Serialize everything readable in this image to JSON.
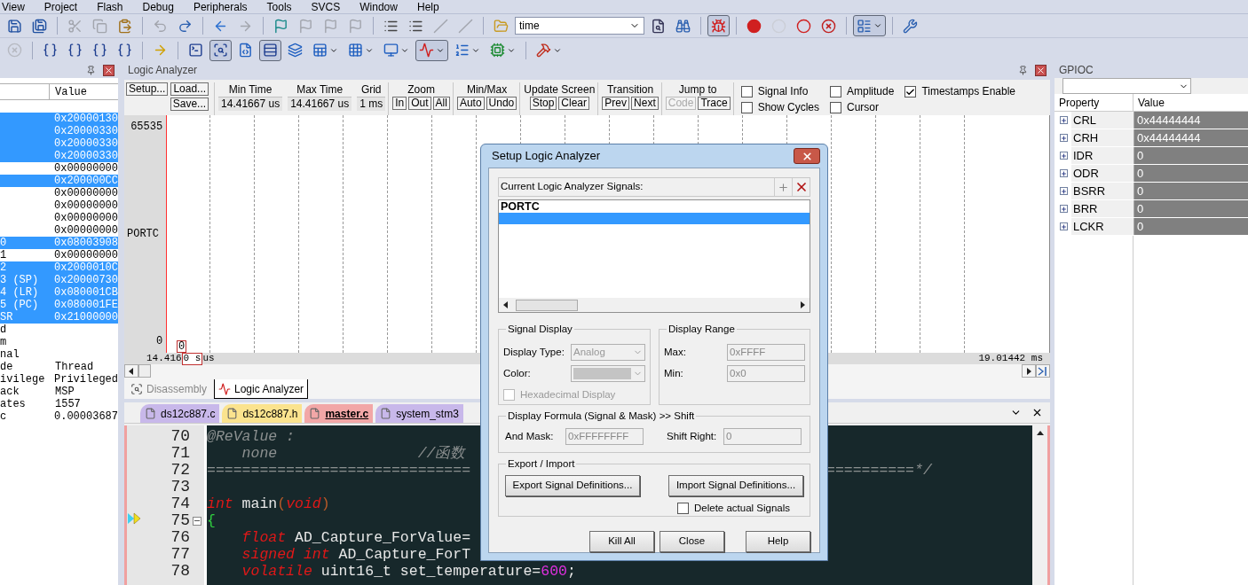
{
  "menu": [
    "View",
    "Project",
    "Flash",
    "Debug",
    "Peripherals",
    "Tools",
    "SVCS",
    "Window",
    "Help"
  ],
  "toolbar_1": [
    {
      "kind": "button",
      "disabled": false,
      "pressed": false
    },
    {
      "kind": "button",
      "disabled": false,
      "pressed": false
    },
    {
      "kind": "separator"
    },
    {
      "kind": "button",
      "disabled": true,
      "pressed": false
    },
    {
      "kind": "button",
      "disabled": true,
      "pressed": false
    },
    {
      "kind": "button",
      "disabled": false,
      "pressed": false
    },
    {
      "kind": "separator"
    },
    {
      "kind": "button",
      "disabled": true,
      "pressed": false
    },
    {
      "kind": "button",
      "disabled": false,
      "pressed": false
    },
    {
      "kind": "separator"
    },
    {
      "kind": "button",
      "disabled": false,
      "pressed": false
    },
    {
      "kind": "button",
      "disabled": true,
      "pressed": false
    },
    {
      "kind": "separator"
    },
    {
      "kind": "button",
      "disabled": false,
      "pressed": false
    },
    {
      "kind": "button",
      "disabled": true,
      "pressed": false
    },
    {
      "kind": "button",
      "disabled": true,
      "pressed": false
    },
    {
      "kind": "button",
      "disabled": true,
      "pressed": false
    },
    {
      "kind": "separator"
    },
    {
      "kind": "button",
      "disabled": false,
      "pressed": false
    },
    {
      "kind": "button",
      "disabled": false,
      "pressed": false
    },
    {
      "kind": "button",
      "disabled": true,
      "pressed": false
    },
    {
      "kind": "button",
      "disabled": true,
      "pressed": false
    },
    {
      "kind": "separator"
    },
    {
      "kind": "button",
      "disabled": false,
      "pressed": false
    },
    {
      "kind": "combo",
      "value": "time"
    },
    {
      "kind": "button",
      "disabled": false,
      "pressed": false
    },
    {
      "kind": "button",
      "disabled": false,
      "pressed": false
    },
    {
      "kind": "separator"
    },
    {
      "kind": "button",
      "disabled": false,
      "pressed": true
    },
    {
      "kind": "separator"
    },
    {
      "kind": "button",
      "disabled": false,
      "pressed": false
    },
    {
      "kind": "button",
      "disabled": true,
      "pressed": false
    },
    {
      "kind": "button",
      "disabled": false,
      "pressed": false
    },
    {
      "kind": "button",
      "disabled": false,
      "pressed": false
    },
    {
      "kind": "separator"
    },
    {
      "kind": "split",
      "disabled": false,
      "pressed": true
    },
    {
      "kind": "separator"
    },
    {
      "kind": "button",
      "disabled": false,
      "pressed": false
    }
  ],
  "toolbar_2": [
    {
      "kind": "button",
      "disabled": true,
      "pressed": false
    },
    {
      "kind": "separator"
    },
    {
      "kind": "button",
      "disabled": false,
      "pressed": false
    },
    {
      "kind": "button",
      "disabled": false,
      "pressed": false
    },
    {
      "kind": "button",
      "disabled": false,
      "pressed": false
    },
    {
      "kind": "button",
      "disabled": false,
      "pressed": false
    },
    {
      "kind": "separator"
    },
    {
      "kind": "button",
      "disabled": false,
      "pressed": false
    },
    {
      "kind": "separator"
    },
    {
      "kind": "button",
      "disabled": false,
      "pressed": false
    },
    {
      "kind": "button",
      "disabled": false,
      "pressed": true
    },
    {
      "kind": "button",
      "disabled": false,
      "pressed": false
    },
    {
      "kind": "button",
      "disabled": false,
      "pressed": true
    },
    {
      "kind": "button",
      "disabled": false,
      "pressed": false
    },
    {
      "kind": "split",
      "disabled": false,
      "pressed": false
    },
    {
      "kind": "split",
      "disabled": false,
      "pressed": false
    },
    {
      "kind": "split",
      "disabled": false,
      "pressed": false
    },
    {
      "kind": "split",
      "disabled": false,
      "pressed": true
    },
    {
      "kind": "split",
      "disabled": false,
      "pressed": false
    },
    {
      "kind": "split",
      "disabled": false,
      "pressed": false
    },
    {
      "kind": "separator"
    },
    {
      "kind": "split",
      "disabled": false,
      "pressed": false
    }
  ],
  "registers": {
    "value_column": "Value",
    "rows": [
      {
        "value": "0x20000130",
        "selected": true
      },
      {
        "value": "0x20000330",
        "selected": true
      },
      {
        "value": "0x20000330",
        "selected": true
      },
      {
        "value": "0x20000330",
        "selected": true
      },
      {
        "value": "0x00000000",
        "selected": false
      },
      {
        "value": "0x200000CC",
        "selected": true
      },
      {
        "value": "0x00000000",
        "selected": false
      },
      {
        "value": "0x00000000",
        "selected": false
      },
      {
        "value": "0x00000000",
        "selected": false
      },
      {
        "value": "0x00000000",
        "selected": false
      },
      {
        "name": "0",
        "value": "0x08003908",
        "selected": true
      },
      {
        "name": "1",
        "value": "0x00000000",
        "selected": false
      },
      {
        "name": "2",
        "value": "0x2000010C",
        "selected": true
      },
      {
        "name": "3 (SP)",
        "value": "0x20000730",
        "selected": true
      },
      {
        "name": "4 (LR)",
        "value": "0x080001CB",
        "selected": true
      },
      {
        "name": "5 (PC)",
        "value": "0x080001FE",
        "selected": true
      },
      {
        "name": "SR",
        "value": "0x21000000",
        "selected": true
      },
      {
        "name": "d",
        "selected": false
      },
      {
        "name": "m",
        "selected": false
      },
      {
        "name": "nal",
        "selected": false
      },
      {
        "name": "de",
        "value": "Thread",
        "selected": false
      },
      {
        "name": "ivilege",
        "value": "Privileged",
        "selected": false
      },
      {
        "name": "ack",
        "value": "MSP",
        "selected": false
      },
      {
        "name": "ates",
        "value": "1557",
        "selected": false
      },
      {
        "name": "c",
        "value": "0.00003687",
        "selected": false
      }
    ]
  },
  "logic_analyzer": {
    "title": "Logic Analyzer",
    "setup": "Setup...",
    "load": "Load...",
    "save": "Save...",
    "sections": [
      {
        "kind": "readout",
        "title": "Min Time",
        "value": "14.41667 us"
      },
      {
        "kind": "readout",
        "title": "Max Time",
        "value": "14.41667 us"
      },
      {
        "kind": "readout",
        "title": "Grid",
        "value": "1 ms"
      },
      {
        "kind": "buttons",
        "title": "Zoom",
        "buttons": [
          {
            "label": "In",
            "disabled": false
          },
          {
            "label": "Out",
            "disabled": false
          },
          {
            "label": "All",
            "disabled": false
          }
        ]
      },
      {
        "kind": "buttons",
        "title": "Min/Max",
        "buttons": [
          {
            "label": "Auto",
            "disabled": false
          },
          {
            "label": "Undo",
            "disabled": false
          }
        ]
      },
      {
        "kind": "buttons",
        "title": "Update Screen",
        "buttons": [
          {
            "label": "Stop",
            "disabled": false
          },
          {
            "label": "Clear",
            "disabled": false
          }
        ]
      },
      {
        "kind": "buttons",
        "title": "Transition",
        "buttons": [
          {
            "label": "Prev",
            "disabled": false
          },
          {
            "label": "Next",
            "disabled": false
          }
        ]
      },
      {
        "kind": "buttons",
        "title": "Jump to",
        "buttons": [
          {
            "label": "Code",
            "disabled": true
          },
          {
            "label": "Trace",
            "disabled": false
          }
        ]
      }
    ],
    "options": [
      {
        "label": "Signal Info",
        "checked": false
      },
      {
        "label": "Show Cycles",
        "checked": false
      },
      {
        "label": "Amplitude",
        "checked": false
      },
      {
        "label": "Cursor",
        "checked": false
      },
      {
        "label": "Timestamps Enable",
        "checked": true
      }
    ],
    "plot": {
      "y_max": "65535",
      "signal": "PORTC",
      "y_min": "0",
      "cursor_value": "0",
      "time_start": "14.416",
      "cursor_time": "0 s",
      "time_start_unit": "us",
      "time_end": "19.01442 ms"
    }
  },
  "bottom_tabs": [
    {
      "label": "Disassembly",
      "selected": false
    },
    {
      "label": "Logic Analyzer",
      "selected": true
    }
  ],
  "editor": {
    "tabs": [
      {
        "label": "ds12c887.c",
        "color": "#c8b8ea",
        "selected": false
      },
      {
        "label": "ds12c887.h",
        "color": "#fbe38e",
        "selected": false
      },
      {
        "label": "master.c",
        "color": "#f2a7a7",
        "selected": true
      },
      {
        "label": "system_stm3",
        "color": "#c8b8ea",
        "selected": false
      }
    ],
    "lines": [
      {
        "number": "70",
        "left": [
          {
            "kind": "comment",
            "text": "@ReValue :"
          }
        ]
      },
      {
        "number": "71",
        "left": [
          {
            "kind": "comment",
            "text": "    none                //函数"
          }
        ]
      },
      {
        "number": "72",
        "left": [
          {
            "kind": "comment",
            "text": "=============================="
          }
        ],
        "right": [
          {
            "kind": "comment",
            "text": "==========*/"
          }
        ]
      },
      {
        "number": "73"
      },
      {
        "number": "74",
        "left": [
          {
            "kind": "keyword",
            "text": "int"
          },
          {
            "kind": "plain",
            "text": " main"
          },
          {
            "kind": "paren",
            "text": "("
          },
          {
            "kind": "keyword",
            "text": "void"
          },
          {
            "kind": "paren",
            "text": ")"
          }
        ]
      },
      {
        "number": "75",
        "current": true,
        "fold": true,
        "left": [
          {
            "kind": "brace",
            "text": "{"
          }
        ]
      },
      {
        "number": "76",
        "left": [
          {
            "kind": "keyword",
            "text": "    float"
          },
          {
            "kind": "plain",
            "text": " AD_Capture_ForValue="
          }
        ]
      },
      {
        "number": "77",
        "left": [
          {
            "kind": "keyword",
            "text": "    signed int"
          },
          {
            "kind": "plain",
            "text": " AD_Capture_ForT"
          }
        ]
      },
      {
        "number": "78",
        "left": [
          {
            "kind": "keyword",
            "text": "    volatile"
          },
          {
            "kind": "plain",
            "text": " uint16_t set_temperature="
          },
          {
            "kind": "number",
            "text": "600"
          },
          {
            "kind": "plain",
            "text": ";"
          }
        ]
      }
    ]
  },
  "gpioc": {
    "title": "GPIOC",
    "columns": [
      "Property",
      "Value"
    ],
    "rows": [
      {
        "name": "CRL",
        "value": "0x44444444"
      },
      {
        "name": "CRH",
        "value": "0x44444444"
      },
      {
        "name": "IDR",
        "value": "0"
      },
      {
        "name": "ODR",
        "value": "0"
      },
      {
        "name": "BSRR",
        "value": "0"
      },
      {
        "name": "BRR",
        "value": "0"
      },
      {
        "name": "LCKR",
        "value": "0"
      }
    ]
  },
  "dialog": {
    "title": "Setup Logic Analyzer",
    "signals_label": "Current Logic Analyzer Signals:",
    "signals": [
      {
        "label": "PORTC"
      }
    ],
    "new_entry_selected": true,
    "signal_display": {
      "title": "Signal Display",
      "type_label": "Display Type:",
      "type_value": "Analog",
      "color_label": "Color:",
      "disabled": true,
      "hex": {
        "label": "Hexadecimal Display",
        "checked": false
      }
    },
    "range": {
      "title": "Display Range",
      "max_label": "Max:",
      "max": "0xFFFF",
      "min_label": "Min:",
      "min": "0x0"
    },
    "formula": {
      "title": "Display Formula (Signal & Mask) >> Shift",
      "mask_label": "And Mask:",
      "mask": "0xFFFFFFFF",
      "shift_label": "Shift Right:",
      "shift": "0"
    },
    "export": {
      "title": "Export / Import",
      "export_button": "Export Signal Definitions...",
      "import_button": "Import Signal Definitions...",
      "delete": {
        "label": "Delete actual Signals",
        "checked": false
      }
    },
    "buttons": [
      "Kill All",
      "Close",
      "Help"
    ]
  }
}
